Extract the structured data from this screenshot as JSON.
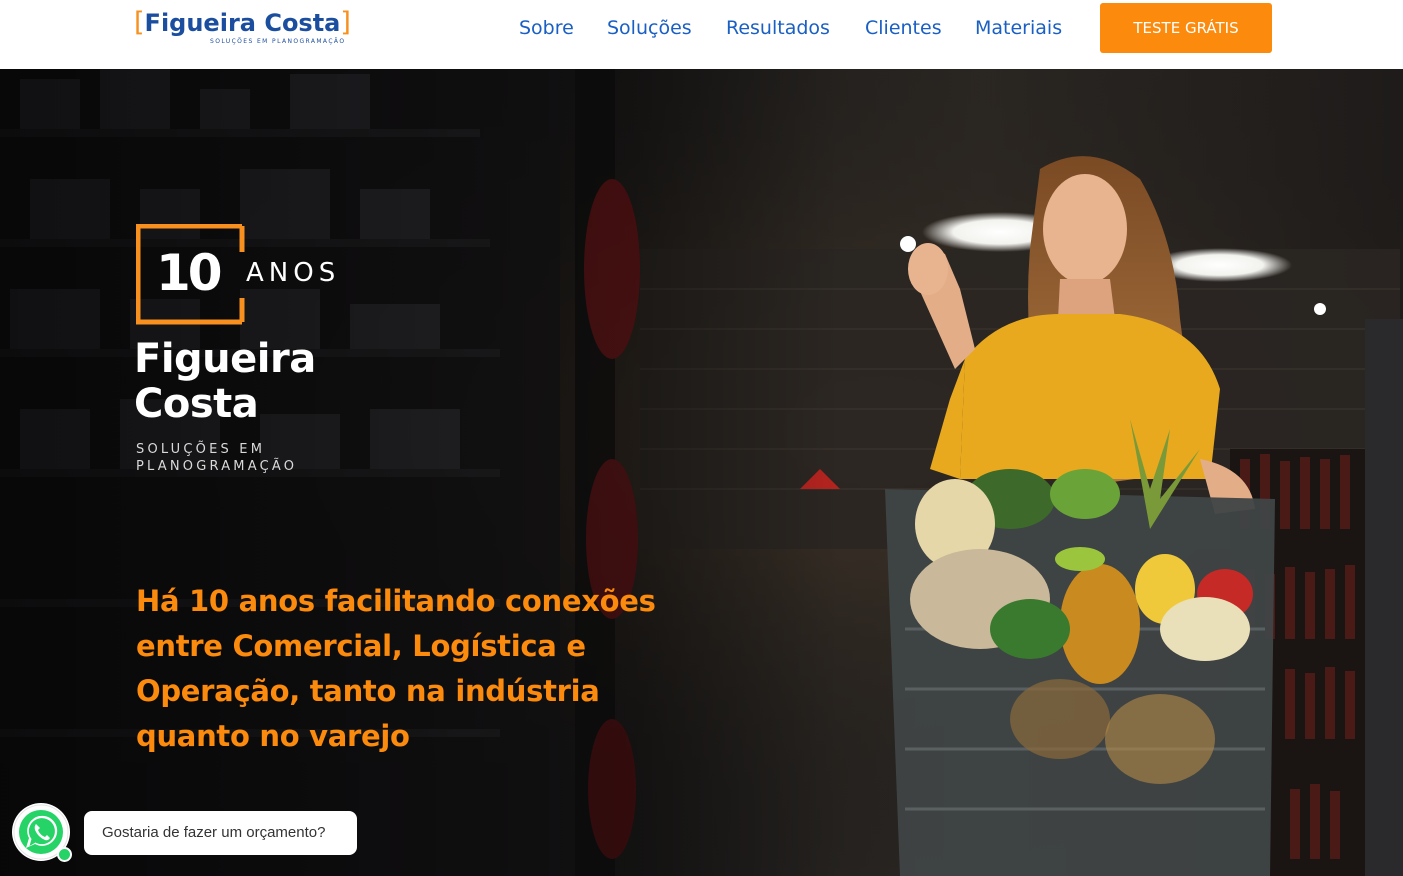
{
  "header": {
    "logo": {
      "open_bracket": "[",
      "name": "Figueira Costa",
      "close_bracket": "]",
      "subtitle": "SOLUÇÕES EM PLANOGRAMAÇÃO"
    },
    "nav": [
      {
        "label": "Sobre"
      },
      {
        "label": "Soluções"
      },
      {
        "label": "Resultados"
      },
      {
        "label": "Clientes"
      },
      {
        "label": "Materiais"
      }
    ],
    "cta_label": "TESTE GRÁTIS"
  },
  "hero": {
    "badge": {
      "number": "10",
      "word": "ANOS"
    },
    "wordmark": {
      "line1": "Figueira",
      "line2": "Costa"
    },
    "tagline": {
      "line1": "SOLUÇÕES EM",
      "line2": "PLANOGRAMAÇÃO"
    },
    "headline": {
      "line1": "Há 10 anos facilitando conexões",
      "line2": "entre Comercial, Logística e",
      "line3": "Operação, tanto na indústria",
      "line4": "quanto no varejo"
    },
    "photo_icon": "supermarket-shopper-photo"
  },
  "whatsapp": {
    "icon": "whatsapp-icon",
    "message": "Gostaria de fazer um orçamento?"
  },
  "colors": {
    "brand_blue": "#1b4e9e",
    "nav_blue": "#1a5fc4",
    "orange": "#fb8a0d",
    "whatsapp_green": "#25d366"
  }
}
